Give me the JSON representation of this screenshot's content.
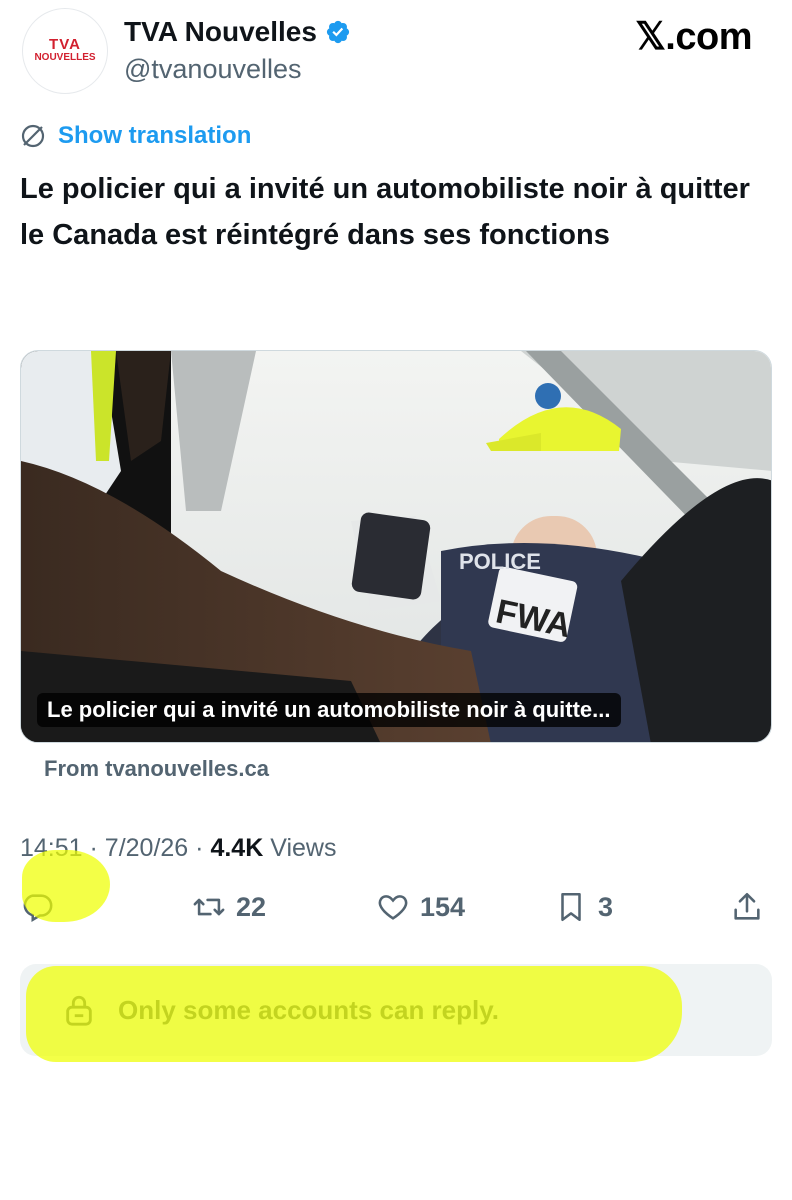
{
  "header": {
    "avatar_logo_line1": "TVA",
    "avatar_logo_line2": "NOUVELLES",
    "display_name": "TVA Nouvelles",
    "handle": "@tvanouvelles",
    "site_watermark": "𝕏.com"
  },
  "tweet": {
    "show_translation_label": "Show translation",
    "text": "Le policier qui a invité un automobiliste noir à quitter le Canada est réintégré dans ses fonctions"
  },
  "card": {
    "caption": "Le policier qui a invité un automobiliste noir à quitte...",
    "source": "From tvanouvelles.ca",
    "plate_text": "FWA",
    "vest_text": "POLICE"
  },
  "meta": {
    "time": "14:51",
    "date": "7/20/26",
    "views_count": "4.4K",
    "views_label": "Views"
  },
  "actions": {
    "reply_icon": "reply-icon",
    "retweet_count": "22",
    "like_count": "154",
    "bookmark_count": "3",
    "share_icon": "share-icon"
  },
  "reply_restriction": {
    "text": "Only some accounts can reply."
  },
  "colors": {
    "accent": "#1d9bf0",
    "muted": "#536471",
    "highlighter": "#eeff00",
    "brand_red": "#d2202f"
  }
}
